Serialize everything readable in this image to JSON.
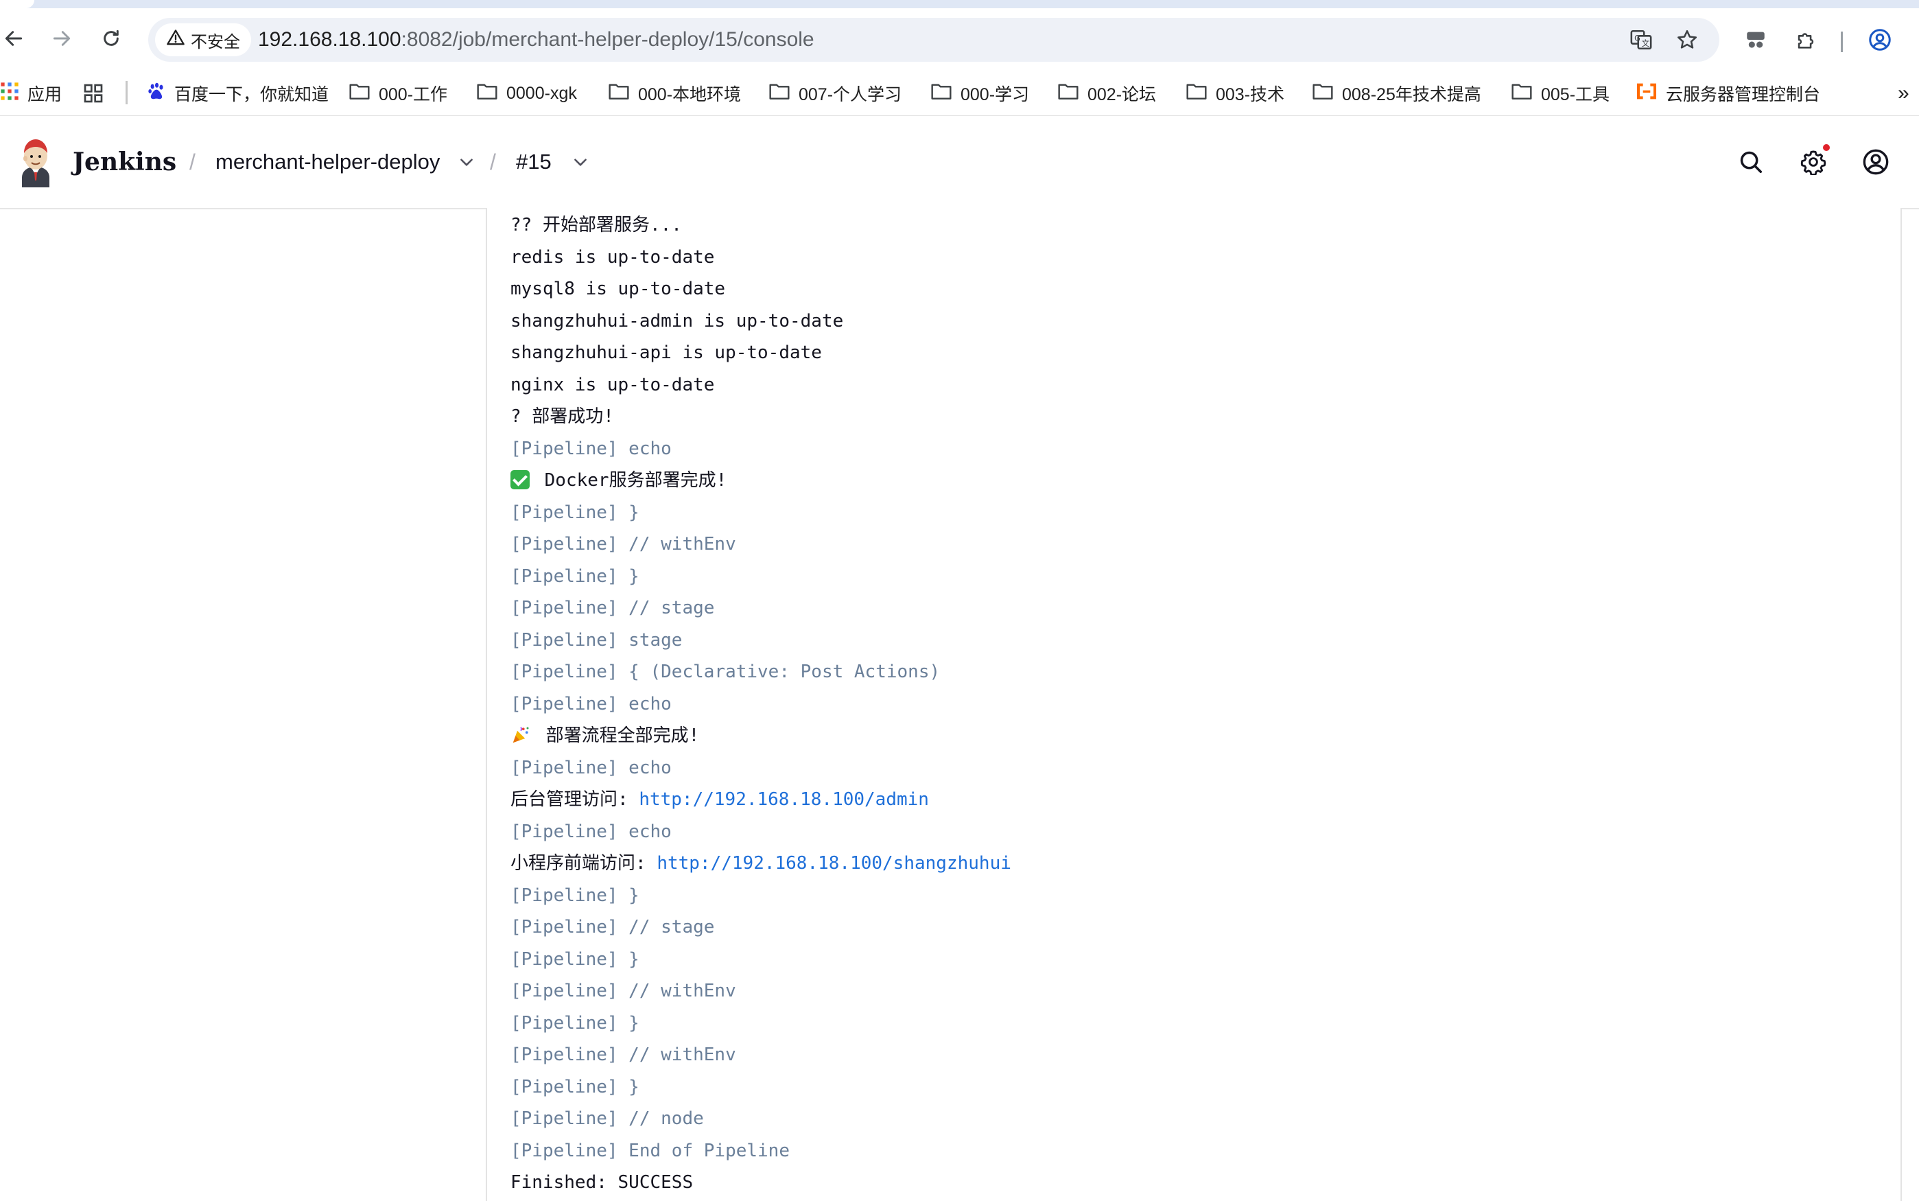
{
  "browser": {
    "security_label": "不安全",
    "url_host": "192.168.18.100",
    "url_rest": ":8082/job/merchant-helper-deploy/15/console"
  },
  "bookmarks": {
    "apps_label": "应用",
    "items": [
      {
        "label": "百度一下，你就知道",
        "icon": "baidu-paw-icon"
      },
      {
        "label": "000-工作",
        "icon": "folder-icon"
      },
      {
        "label": "0000-xgk",
        "icon": "folder-icon"
      },
      {
        "label": "000-本地环境",
        "icon": "folder-icon"
      },
      {
        "label": "007-个人学习",
        "icon": "folder-icon"
      },
      {
        "label": "000-学习",
        "icon": "folder-icon"
      },
      {
        "label": "002-论坛",
        "icon": "folder-icon"
      },
      {
        "label": "003-技术",
        "icon": "folder-icon"
      },
      {
        "label": "008-25年技术提高",
        "icon": "folder-icon"
      },
      {
        "label": "005-工具",
        "icon": "folder-icon"
      },
      {
        "label": "云服务器管理控制台",
        "icon": "aliyun-icon"
      }
    ],
    "overflow": "»"
  },
  "jenkins": {
    "brand": "Jenkins",
    "crumbs": {
      "sep": "/",
      "job": "merchant-helper-deploy",
      "build": "#15"
    }
  },
  "console": {
    "lines": [
      {
        "kind": "plain",
        "text": "?? 开始部署服务..."
      },
      {
        "kind": "plain",
        "text": "redis is up-to-date"
      },
      {
        "kind": "plain",
        "text": "mysql8 is up-to-date"
      },
      {
        "kind": "plain",
        "text": "shangzhuhui-admin is up-to-date"
      },
      {
        "kind": "plain",
        "text": "shangzhuhui-api is up-to-date"
      },
      {
        "kind": "plain",
        "text": "nginx is up-to-date"
      },
      {
        "kind": "plain",
        "text": "? 部署成功!"
      },
      {
        "kind": "pipeline",
        "text": "[Pipeline] echo"
      },
      {
        "kind": "plain",
        "text": " Docker服务部署完成!"
      },
      {
        "kind": "pipeline",
        "text": "[Pipeline] }"
      },
      {
        "kind": "pipeline",
        "text": "[Pipeline] // withEnv"
      },
      {
        "kind": "pipeline",
        "text": "[Pipeline] }"
      },
      {
        "kind": "pipeline",
        "text": "[Pipeline] // stage"
      },
      {
        "kind": "pipeline",
        "text": "[Pipeline] stage"
      },
      {
        "kind": "pipeline",
        "text": "[Pipeline] { (Declarative: Post Actions)"
      },
      {
        "kind": "pipeline",
        "text": "[Pipeline] echo"
      },
      {
        "kind": "plain",
        "text": " 部署流程全部完成!"
      },
      {
        "kind": "pipeline",
        "text": "[Pipeline] echo"
      },
      {
        "kind": "link",
        "prefix": "后台管理访问: ",
        "link": "http://192.168.18.100/admin"
      },
      {
        "kind": "pipeline",
        "text": "[Pipeline] echo"
      },
      {
        "kind": "link",
        "prefix": "小程序前端访问: ",
        "link": "http://192.168.18.100/shangzhuhui"
      },
      {
        "kind": "pipeline",
        "text": "[Pipeline] }"
      },
      {
        "kind": "pipeline",
        "text": "[Pipeline] // stage"
      },
      {
        "kind": "pipeline",
        "text": "[Pipeline] }"
      },
      {
        "kind": "pipeline",
        "text": "[Pipeline] // withEnv"
      },
      {
        "kind": "pipeline",
        "text": "[Pipeline] }"
      },
      {
        "kind": "pipeline",
        "text": "[Pipeline] // withEnv"
      },
      {
        "kind": "pipeline",
        "text": "[Pipeline] }"
      },
      {
        "kind": "pipeline",
        "text": "[Pipeline] // node"
      },
      {
        "kind": "pipeline",
        "text": "[Pipeline] End of Pipeline"
      },
      {
        "kind": "plain",
        "text": "Finished: SUCCESS"
      }
    ]
  },
  "colors": {
    "pipeline_text": "#6a7f99",
    "link": "#1e6fd9",
    "notification_dot": "#e0212b"
  }
}
